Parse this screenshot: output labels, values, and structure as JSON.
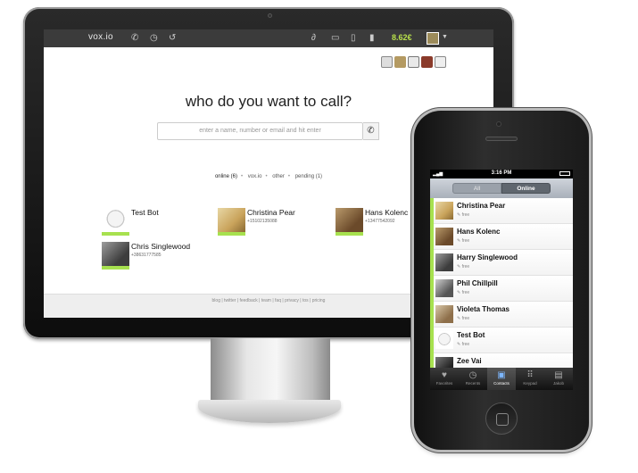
{
  "desktop": {
    "brand": "vox.io",
    "balance": "8.62€",
    "call_title": "who do you want to call?",
    "search_placeholder": "enter a name, number or email and hit enter",
    "filters": [
      "online (6)",
      "vox.io",
      "other",
      "pending (1)"
    ],
    "contacts": [
      {
        "name": "Test Bot",
        "phone": ""
      },
      {
        "name": "Christina Pear",
        "phone": "+15102135088"
      },
      {
        "name": "Hans Kolenc",
        "phone": "+13477542092"
      },
      {
        "name": "Chris Singlewood",
        "phone": "+38631777585"
      }
    ],
    "footer_links": "blog | twitter | feedback | team | faq | privacy | tos | pricing"
  },
  "phone": {
    "time": "3:16 PM",
    "segments": [
      "All",
      "Online"
    ],
    "contacts": [
      {
        "name": "Christina Pear",
        "status": "free"
      },
      {
        "name": "Hans Kolenc",
        "status": "free"
      },
      {
        "name": "Harry Singlewood",
        "status": "free"
      },
      {
        "name": "Phil Chillpill",
        "status": "free"
      },
      {
        "name": "Violeta Thomas",
        "status": "free"
      },
      {
        "name": "Test Bot",
        "status": "free"
      },
      {
        "name": "Zee Vai",
        "status": ""
      }
    ],
    "tabs": [
      "Favorites",
      "Recents",
      "Contacts",
      "Keypad",
      "Jakob"
    ]
  },
  "colors": {
    "accent_green": "#a7e14f",
    "balance_green": "#b8e04b",
    "topbar": "#3b3b3b"
  }
}
